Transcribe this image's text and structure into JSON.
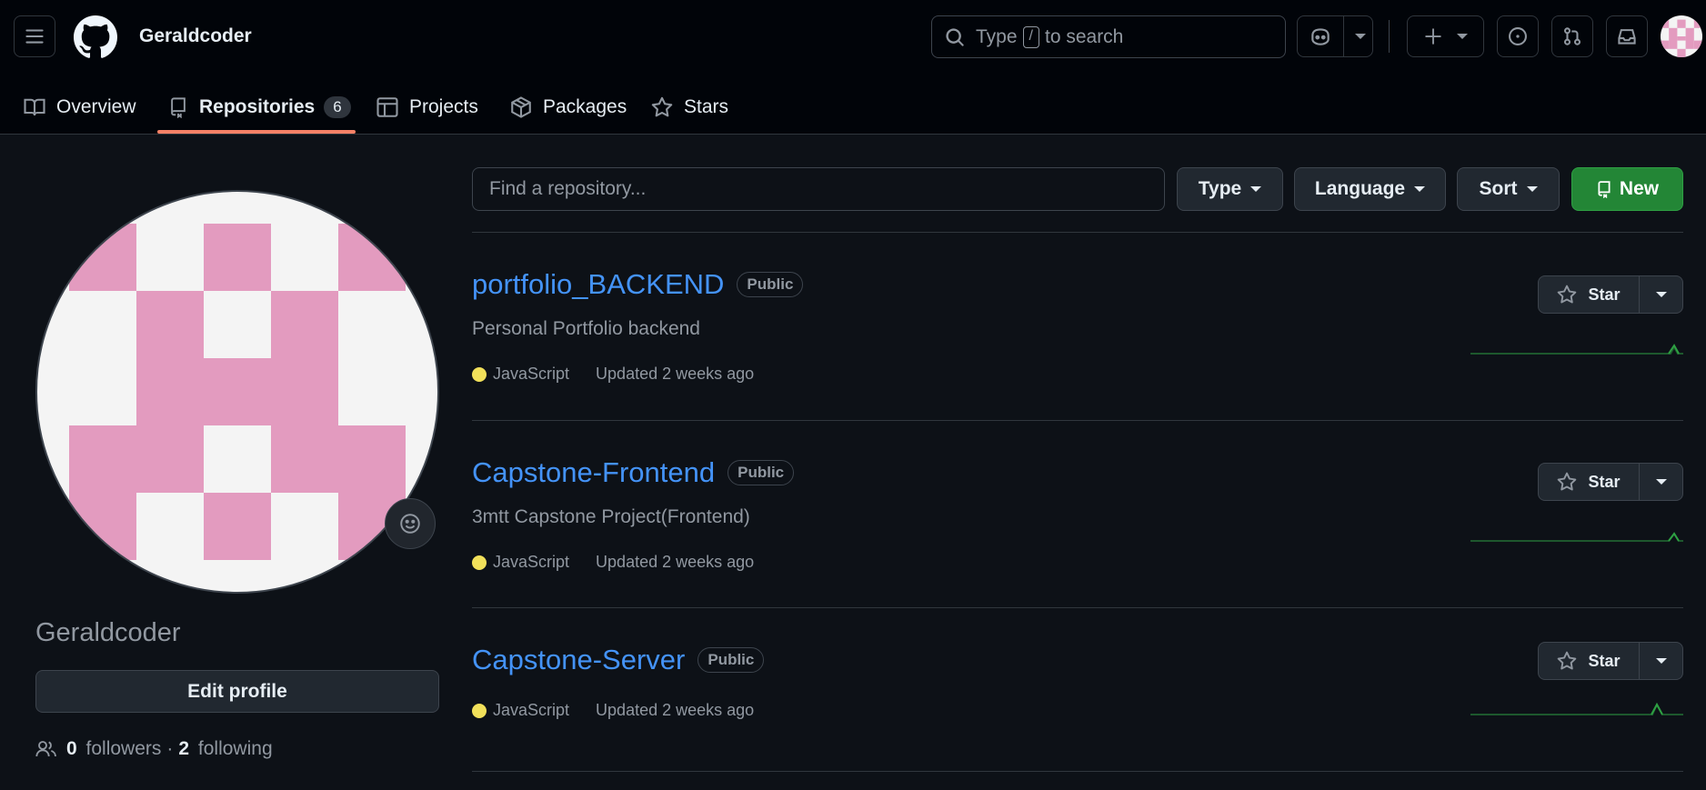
{
  "header": {
    "username": "Geraldcoder",
    "search_placeholder_before": "Type",
    "search_key": "/",
    "search_placeholder_after": "to search"
  },
  "tabs": [
    {
      "label": "Overview",
      "icon": "book-icon"
    },
    {
      "label": "Repositories",
      "icon": "repo-icon",
      "count": "6",
      "selected": true
    },
    {
      "label": "Projects",
      "icon": "table-icon"
    },
    {
      "label": "Packages",
      "icon": "package-icon"
    },
    {
      "label": "Stars",
      "icon": "star-icon"
    }
  ],
  "sidebar": {
    "name": "Geraldcoder",
    "edit_profile": "Edit profile",
    "followers_count": "0",
    "followers_label": "followers",
    "separator": "·",
    "following_count": "2",
    "following_label": "following"
  },
  "toolbar": {
    "find_placeholder": "Find a repository...",
    "type_label": "Type",
    "language_label": "Language",
    "sort_label": "Sort",
    "new_label": "New"
  },
  "repos": [
    {
      "name": "portfolio_BACKEND",
      "visibility": "Public",
      "description": "Personal Portfolio backend",
      "language": "JavaScript",
      "language_color": "#f1e05a",
      "updated": "Updated 2 weeks ago",
      "star_label": "Star"
    },
    {
      "name": "Capstone-Frontend",
      "visibility": "Public",
      "description": "3mtt Capstone Project(Frontend)",
      "language": "JavaScript",
      "language_color": "#f1e05a",
      "updated": "Updated 2 weeks ago",
      "star_label": "Star"
    },
    {
      "name": "Capstone-Server",
      "visibility": "Public",
      "description": "",
      "language": "JavaScript",
      "language_color": "#f1e05a",
      "updated": "Updated 2 weeks ago",
      "star_label": "Star"
    }
  ],
  "colors": {
    "accent_link": "#4493f8",
    "tab_underline": "#f78166",
    "new_button": "#238636",
    "sparkline": "#2ea043",
    "avatar_pink": "#e39bbf"
  }
}
